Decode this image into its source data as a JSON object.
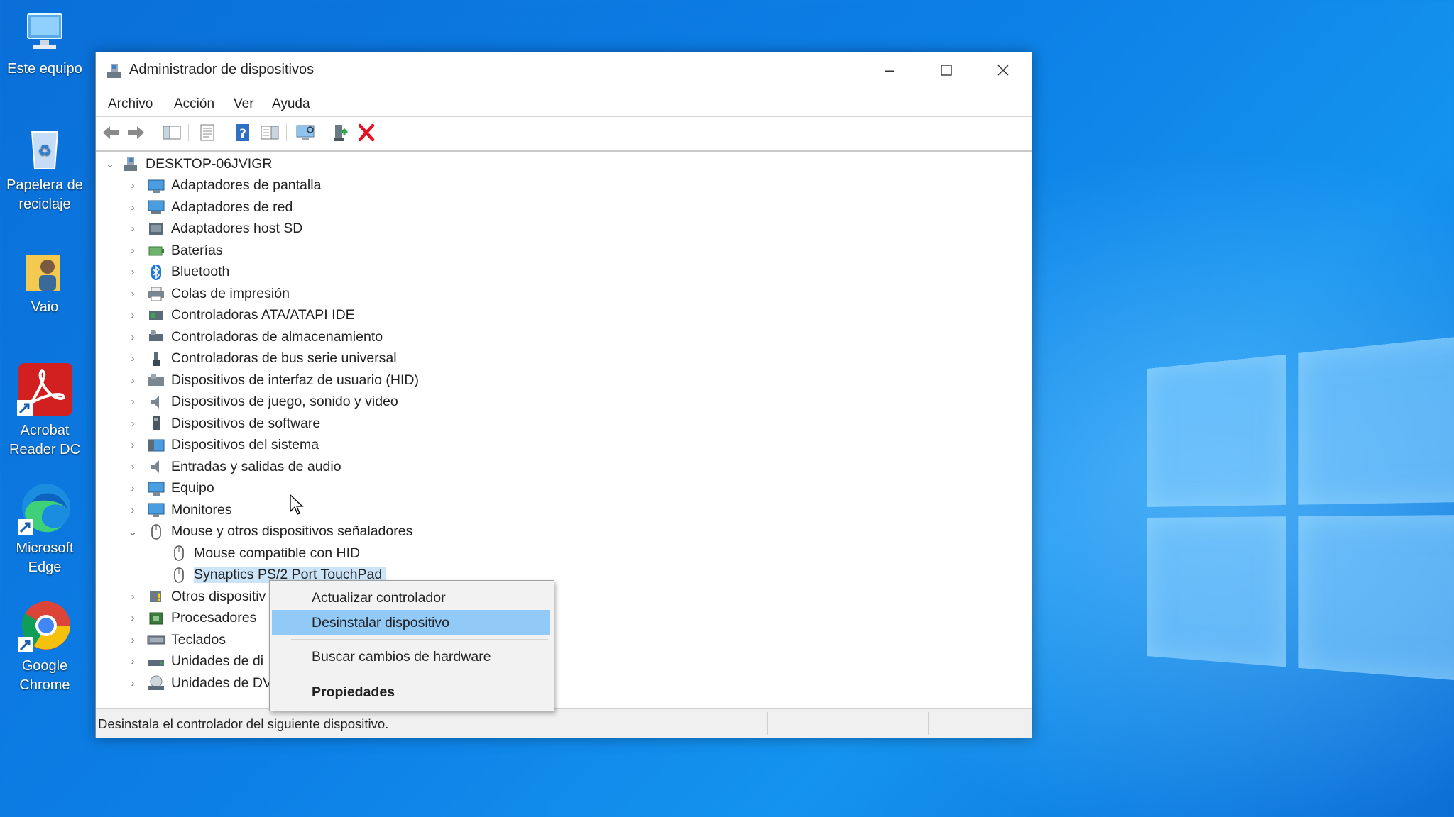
{
  "desktop": {
    "icons": [
      {
        "label_line1": "Este equipo",
        "label_line2": ""
      },
      {
        "label_line1": "Papelera de",
        "label_line2": "reciclaje"
      },
      {
        "label_line1": "Vaio",
        "label_line2": ""
      },
      {
        "label_line1": "Acrobat",
        "label_line2": "Reader DC"
      },
      {
        "label_line1": "Microsoft",
        "label_line2": "Edge"
      },
      {
        "label_line1": "Google",
        "label_line2": "Chrome"
      }
    ]
  },
  "window": {
    "title": "Administrador de dispositivos",
    "menu": [
      "Archivo",
      "Acción",
      "Ver",
      "Ayuda"
    ],
    "status_text": "Desinstala el controlador del siguiente dispositivo."
  },
  "tree": {
    "root": "DESKTOP-06JVIGR",
    "categories": [
      {
        "label": "Adaptadores de pantalla",
        "icon": "display-adapter-icon"
      },
      {
        "label": "Adaptadores de red",
        "icon": "network-adapter-icon"
      },
      {
        "label": "Adaptadores host SD",
        "icon": "sd-host-icon"
      },
      {
        "label": "Baterías",
        "icon": "battery-icon"
      },
      {
        "label": "Bluetooth",
        "icon": "bluetooth-icon"
      },
      {
        "label": "Colas de impresión",
        "icon": "printer-icon"
      },
      {
        "label": "Controladoras ATA/ATAPI IDE",
        "icon": "ide-controller-icon"
      },
      {
        "label": "Controladoras de almacenamiento",
        "icon": "storage-controller-icon"
      },
      {
        "label": "Controladoras de bus serie universal",
        "icon": "usb-icon"
      },
      {
        "label": "Dispositivos de interfaz de usuario (HID)",
        "icon": "hid-icon"
      },
      {
        "label": "Dispositivos de juego, sonido y video",
        "icon": "speaker-icon"
      },
      {
        "label": "Dispositivos de software",
        "icon": "software-device-icon"
      },
      {
        "label": "Dispositivos del sistema",
        "icon": "system-device-icon"
      },
      {
        "label": "Entradas y salidas de audio",
        "icon": "audio-io-icon"
      },
      {
        "label": "Equipo",
        "icon": "computer-icon"
      },
      {
        "label": "Monitores",
        "icon": "monitor-icon"
      },
      {
        "label": "Mouse y otros dispositivos señaladores",
        "icon": "mouse-icon"
      }
    ],
    "mouse_children": [
      "Mouse compatible con HID",
      "Synaptics PS/2 Port TouchPad"
    ],
    "categories_after": [
      {
        "label": "Otros dispositiv",
        "icon": "other-devices-icon"
      },
      {
        "label": "Procesadores",
        "icon": "processor-icon"
      },
      {
        "label": "Teclados",
        "icon": "keyboard-icon"
      },
      {
        "label": "Unidades de di",
        "icon": "disk-drive-icon"
      },
      {
        "label": "Unidades de DV",
        "icon": "dvd-drive-icon"
      }
    ]
  },
  "context_menu": {
    "items": [
      "Actualizar controlador",
      "Desinstalar dispositivo",
      "Buscar cambios de hardware",
      "Propiedades"
    ]
  },
  "colors": {
    "highlight": "#91c9f7",
    "selection": "#cce4f7",
    "uninstall_red": "#e81123"
  }
}
